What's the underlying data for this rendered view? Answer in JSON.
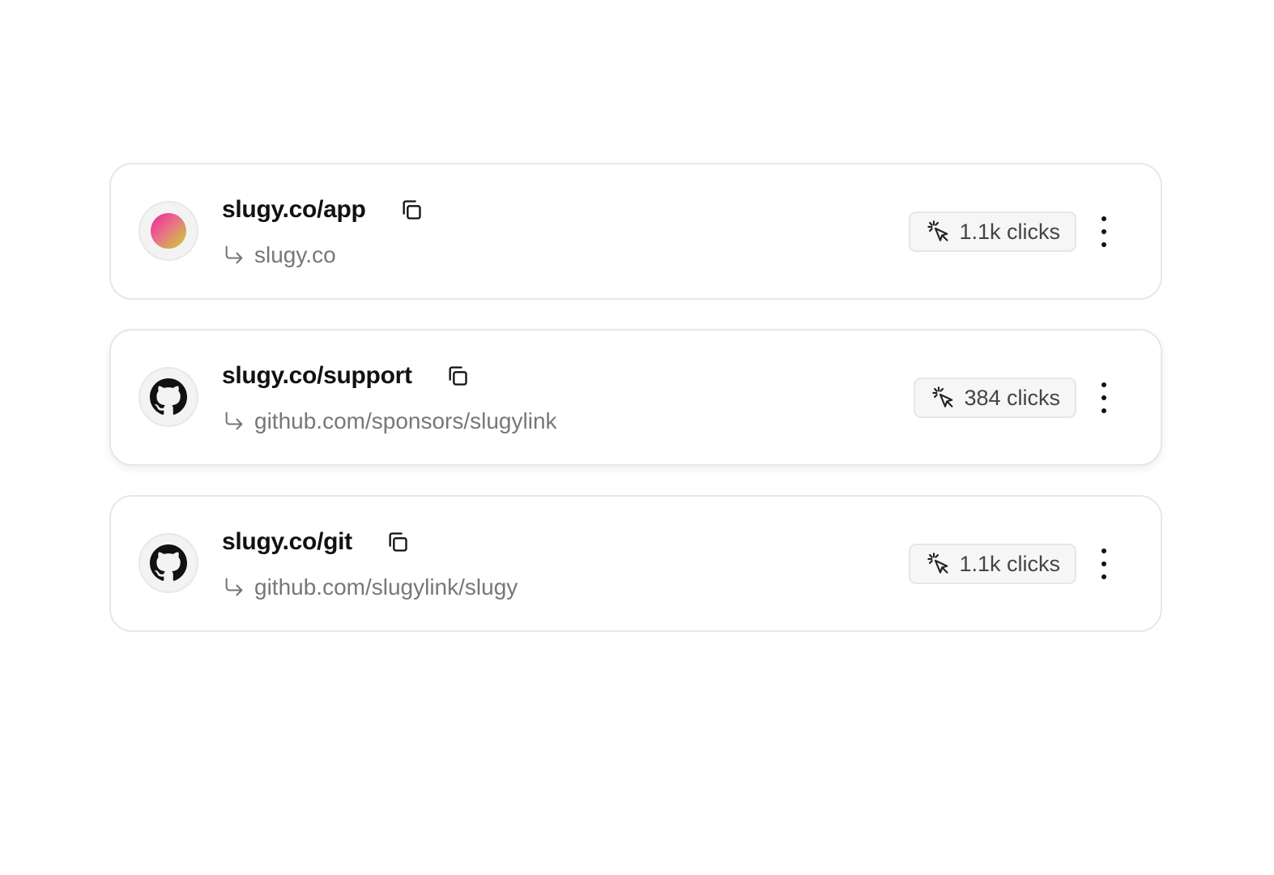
{
  "links": [
    {
      "short_url": "slugy.co/app",
      "destination": "slugy.co",
      "clicks": "1.1k clicks",
      "avatar": "gradient-circle",
      "accent_gradient": [
        "#f0238f",
        "#c9d62a"
      ]
    },
    {
      "short_url": "slugy.co/support",
      "destination": "github.com/sponsors/slugylink",
      "clicks": "384 clicks",
      "avatar": "github-icon"
    },
    {
      "short_url": "slugy.co/git",
      "destination": "github.com/slugylink/slugy",
      "clicks": "1.1k clicks",
      "avatar": "github-icon"
    }
  ]
}
